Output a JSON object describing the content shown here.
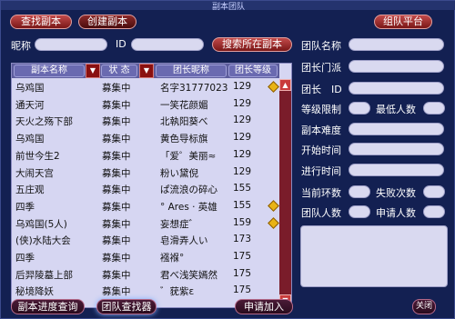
{
  "window": {
    "title": "副本团队"
  },
  "top_buttons": {
    "find_dungeon": "查找副本",
    "create_dungeon": "创建副本",
    "team_platform": "组队平台"
  },
  "search": {
    "nickname_label": "昵称",
    "id_label": "ID",
    "search_button": "搜索所在副本"
  },
  "list": {
    "columns": [
      "副本名称",
      "状 态",
      "团长昵称",
      "团长等级"
    ],
    "rows": [
      {
        "name": "乌鸡国",
        "status": "募集中",
        "leader": "名字31777023",
        "level": "129",
        "icon": true
      },
      {
        "name": "通天河",
        "status": "募集中",
        "leader": "一笑花颜媚",
        "level": "129",
        "icon": false
      },
      {
        "name": "天火之殇下部",
        "status": "募集中",
        "leader": "北執阳葵べ",
        "level": "129",
        "icon": false
      },
      {
        "name": "乌鸡国",
        "status": "募集中",
        "leader": "黄色导标旗",
        "level": "129",
        "icon": false
      },
      {
        "name": "前世今生2",
        "status": "募集中",
        "leader": "「爱゜美丽≈",
        "level": "129",
        "icon": false
      },
      {
        "name": "大闹天宫",
        "status": "募集中",
        "leader": "粉い黛倪",
        "level": "129",
        "icon": false
      },
      {
        "name": "五庄观",
        "status": "募集中",
        "leader": "ぱ流浪の碎心",
        "level": "155",
        "icon": false
      },
      {
        "name": "四季",
        "status": "募集中",
        "leader": "° Ares · 英雄",
        "level": "155",
        "icon": true
      },
      {
        "name": "乌鸡国(5人)",
        "status": "募集中",
        "leader": "妄想症゛",
        "level": "159",
        "icon": true
      },
      {
        "name": "(侠)水陆大会",
        "status": "募集中",
        "leader": "皂滑弄人い",
        "level": "173",
        "icon": false
      },
      {
        "name": "四季",
        "status": "募集中",
        "leader": "襁褓°",
        "level": "175",
        "icon": false
      },
      {
        "name": "后羿陵墓上部",
        "status": "募集中",
        "leader": "君べ浅笑嫣然",
        "level": "175",
        "icon": false
      },
      {
        "name": "秘境降妖",
        "status": "募集中",
        "leader": "゛莸紫ε",
        "level": "175",
        "icon": false
      }
    ]
  },
  "details": {
    "team_name": "团队名称",
    "leader_sect": "团长门派",
    "leader_id": "团长　ID",
    "level_limit": "等级限制",
    "min_people": "最低人数",
    "difficulty": "副本难度",
    "start_time": "开始时间",
    "progress_time": "进行时间",
    "current_round": "当前环数",
    "fail_count": "失败次数",
    "team_size": "团队人数",
    "applicants": "申请人数"
  },
  "bottom": {
    "progress_query": "副本进度查询",
    "team_finder": "团队查找器",
    "apply_join": "申请加入",
    "close": "关闭"
  },
  "colors": {
    "accent_red": "#a02323",
    "list_bg": "#d6d6f2",
    "window_bg": "#132052",
    "diamond": "#e8b316"
  }
}
